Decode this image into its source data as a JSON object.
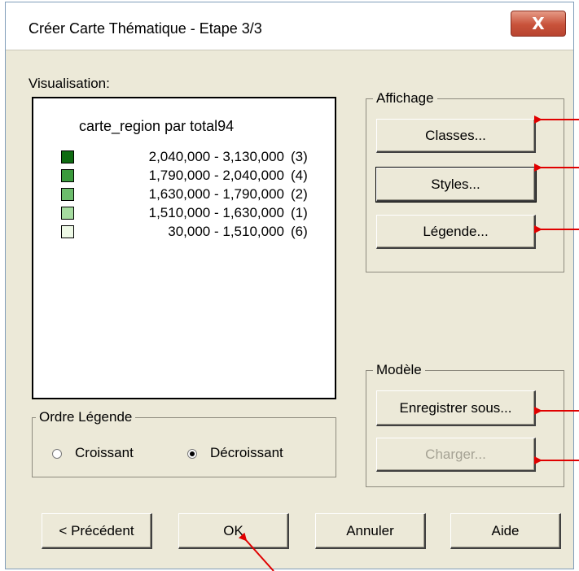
{
  "window": {
    "title": "Créer Carte Thématique - Etape 3/3",
    "close_glyph": "X"
  },
  "visualisation": {
    "label": "Visualisation:",
    "legend_title": "carte_region par total94",
    "rows": [
      {
        "range": "2,040,000 - 3,130,000",
        "count": "(3)",
        "color": "#0f6b12"
      },
      {
        "range": "1,790,000 - 2,040,000",
        "count": "(4)",
        "color": "#3a9a3c"
      },
      {
        "range": "1,630,000 - 1,790,000",
        "count": "(2)",
        "color": "#6cbc6c"
      },
      {
        "range": "1,510,000 - 1,630,000",
        "count": "(1)",
        "color": "#a6dca0"
      },
      {
        "range": "30,000 - 1,510,000",
        "count": "(6)",
        "color": "#eef9e6"
      }
    ]
  },
  "affichage": {
    "label": "Affichage",
    "classes": "Classes...",
    "styles": "Styles...",
    "legende": "Légende..."
  },
  "modele": {
    "label": "Modèle",
    "save_as": "Enregistrer sous...",
    "load": "Charger..."
  },
  "ordre": {
    "label": "Ordre Légende",
    "ascending": "Croissant",
    "descending": "Décroissant",
    "selected": "descending"
  },
  "footer": {
    "previous": "< Précédent",
    "ok": "OK",
    "cancel": "Annuler",
    "help": "Aide"
  },
  "annotation_color": "#e00000"
}
